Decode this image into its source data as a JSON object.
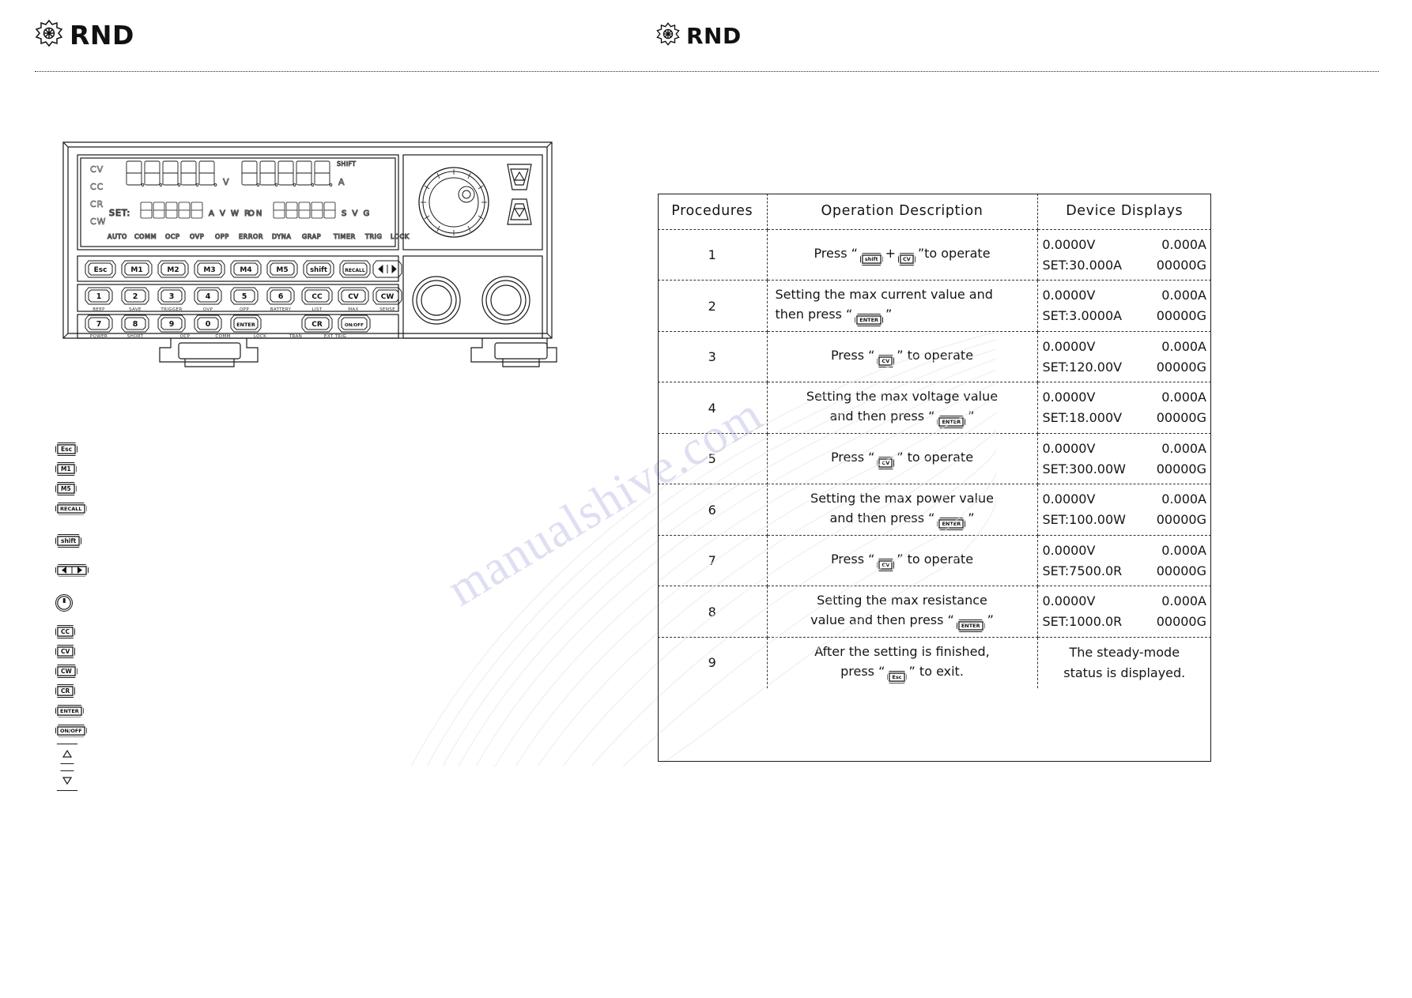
{
  "brand": {
    "left_name": "RND",
    "right_name": "RND",
    "logo_icon": "rnd-flower-logo-icon"
  },
  "device_panel": {
    "lcd": {
      "mode_labels": [
        "CV",
        "CC",
        "CR",
        "CW"
      ],
      "main_digits": "8.8.8.8.8.",
      "main_unit": "V",
      "second_digits": "8.8.8.8.8.",
      "second_unit": "A",
      "shift_label": "SHIFT",
      "set_label": "SET:",
      "set_digits": "88888",
      "set_units": "A V W R",
      "on_label": "ON",
      "aux_digits": "88888",
      "aux_units": "S V G",
      "annunciators": [
        "AUTO",
        "COMM",
        "OCP",
        "OVP",
        "OPP",
        "ERROR",
        "DYNA",
        "GRAP",
        "TIMER",
        "TRIG",
        "LOCK"
      ]
    },
    "keypad_row1": [
      "Esc",
      "M1",
      "M2",
      "M3",
      "M4",
      "M5",
      "shift",
      "RECALL"
    ],
    "keypad_row2": [
      "1",
      "2",
      "3",
      "4",
      "5",
      "6",
      "CC",
      "CV",
      "CW"
    ],
    "keypad_row2_sub": [
      "BEEP",
      "SAVE",
      "TRIGGER",
      "OVP",
      "OPP",
      "BATTERY",
      "LIST",
      "MAX",
      "SENSE"
    ],
    "keypad_row3": [
      "7",
      "8",
      "9",
      "0",
      "ENTER",
      "CR"
    ],
    "keypad_row3_extra": [
      "ON/OFF"
    ],
    "keypad_row3_sub": [
      "POWER",
      "SHORT",
      "OCP",
      "COMM",
      "LOCK",
      "TRAN",
      "EXT TRIG"
    ],
    "arrow_keys": [
      "left-arrow",
      "right-arrow"
    ],
    "knob": "rotary-encoder-knob",
    "terminals": [
      "input-terminal-positive",
      "input-terminal-negative"
    ]
  },
  "key_legend": [
    {
      "label": "Esc",
      "type": "key"
    },
    {
      "label": "M1",
      "type": "key"
    },
    {
      "label": "M5",
      "type": "key"
    },
    {
      "label": "RECALL",
      "type": "key"
    },
    {
      "label": "shift",
      "type": "key"
    },
    {
      "label": "◁ | ▷",
      "type": "arrowkey"
    },
    {
      "label": "",
      "type": "knob"
    },
    {
      "label": "CC",
      "type": "key"
    },
    {
      "label": "CV",
      "type": "key"
    },
    {
      "label": "CW",
      "type": "key"
    },
    {
      "label": "CR",
      "type": "key"
    },
    {
      "label": "ENTER",
      "type": "key"
    },
    {
      "label": "ON/OFF",
      "type": "key"
    },
    {
      "label": "up",
      "type": "arrow-up"
    },
    {
      "label": "down",
      "type": "arrow-down"
    }
  ],
  "table": {
    "headers": {
      "procedures": "Procedures",
      "operation": "Operation Description",
      "displays": "Device Displays"
    },
    "rows": [
      {
        "no": "1",
        "desc_pre": "Press “",
        "desc_key1": "shift",
        "desc_mid": "+",
        "desc_key2": "CV",
        "desc_post": "”to operate",
        "desc_line2": "",
        "disp_l1_left": "0.0000V",
        "disp_l1_right": "0.000A",
        "disp_l2_left": "SET:30.000A",
        "disp_l2_right": "00000G"
      },
      {
        "no": "2",
        "desc_pre": "Setting the max current value and",
        "desc_key1": "",
        "desc_mid": "",
        "desc_key2": "ENTER",
        "desc_post": "”",
        "desc_line2": "then press “",
        "disp_l1_left": "0.0000V",
        "disp_l1_right": "0.000A",
        "disp_l2_left": "SET:3.0000A",
        "disp_l2_right": "00000G"
      },
      {
        "no": "3",
        "desc_pre": "Press “",
        "desc_key1": "",
        "desc_mid": "",
        "desc_key2": "CV",
        "desc_post": "” to operate",
        "desc_line2": "",
        "disp_l1_left": "0.0000V",
        "disp_l1_right": "0.000A",
        "disp_l2_left": "SET:120.00V",
        "disp_l2_right": "00000G"
      },
      {
        "no": "4",
        "desc_pre": "Setting the max voltage value",
        "desc_key1": "",
        "desc_mid": "",
        "desc_key2": "ENTER",
        "desc_post": "”",
        "desc_line2": "and then press “",
        "disp_l1_left": "0.0000V",
        "disp_l1_right": "0.000A",
        "disp_l2_left": "SET:18.000V",
        "disp_l2_right": "00000G"
      },
      {
        "no": "5",
        "desc_pre": "Press “",
        "desc_key1": "",
        "desc_mid": "",
        "desc_key2": "CV",
        "desc_post": "” to operate",
        "desc_line2": "",
        "disp_l1_left": "0.0000V",
        "disp_l1_right": "0.000A",
        "disp_l2_left": "SET:300.00W",
        "disp_l2_right": "00000G"
      },
      {
        "no": "6",
        "desc_pre": "Setting the max power value",
        "desc_key1": "",
        "desc_mid": "",
        "desc_key2": "ENTER",
        "desc_post": "”",
        "desc_line2": "and then press “",
        "disp_l1_left": "0.0000V",
        "disp_l1_right": "0.000A",
        "disp_l2_left": "SET:100.00W",
        "disp_l2_right": "00000G"
      },
      {
        "no": "7",
        "desc_pre": "Press “",
        "desc_key1": "",
        "desc_mid": "",
        "desc_key2": "CV",
        "desc_post": "” to operate",
        "desc_line2": "",
        "disp_l1_left": "0.0000V",
        "disp_l1_right": "0.000A",
        "disp_l2_left": "SET:7500.0R",
        "disp_l2_right": "00000G"
      },
      {
        "no": "8",
        "desc_pre": "Setting the max resistance",
        "desc_key1": "",
        "desc_mid": "",
        "desc_key2": "ENTER",
        "desc_post": "”",
        "desc_line2": "value and then press “",
        "disp_l1_left": "0.0000V",
        "disp_l1_right": "0.000A",
        "disp_l2_left": "SET:1000.0R",
        "disp_l2_right": "00000G"
      },
      {
        "no": "9",
        "desc_pre": "After the setting is finished,",
        "desc_key1": "",
        "desc_mid": "",
        "desc_key2": "Esc",
        "desc_post": "” to exit.",
        "desc_line2": "press “",
        "disp_text_l1": "The steady-mode",
        "disp_text_l2": "status is displayed."
      }
    ]
  },
  "watermark": {
    "text": "manualshive.com"
  }
}
